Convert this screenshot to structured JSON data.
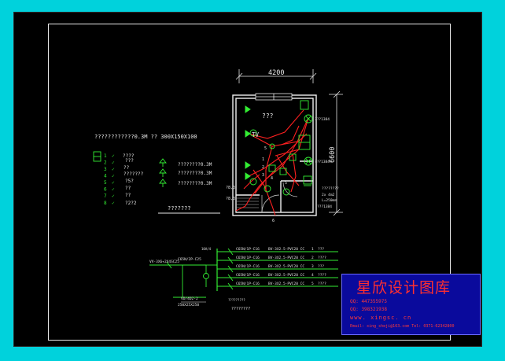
{
  "plan": {
    "width_dim": "4200",
    "height_dim": "6600",
    "room_label": "???",
    "tv_label": "TV",
    "panel_note_1": "???1384",
    "panel_note_2": "???1384",
    "side_note_1": "????????",
    "side_note_2": "2x 4m2",
    "side_note_3": "L=250mm",
    "side_note_4": "???1384",
    "left_tag_1": "?8,3",
    "left_tag_2": "?8,3",
    "circuit_nums": [
      "5",
      "1",
      "2",
      "3",
      "4",
      "5",
      "6"
    ]
  },
  "legend": {
    "heading": "????????????0.3M ?? 300X150X100",
    "items": [
      {
        "num": "1",
        "mark": "✓",
        "text": "????"
      },
      {
        "num": "2",
        "mark": "✓",
        "text": "???"
      },
      {
        "num": "3",
        "mark": "✓",
        "text": "??"
      },
      {
        "num": "4",
        "mark": "✓",
        "text": "???????"
      },
      {
        "num": "5",
        "mark": "✓",
        "text": "?5?"
      },
      {
        "num": "6",
        "mark": "✓",
        "text": "??"
      },
      {
        "num": "7",
        "mark": "✓",
        "text": "??"
      },
      {
        "num": "8",
        "mark": "✓",
        "text": "?2?2"
      }
    ],
    "right_notes": [
      "????????0.3M",
      "????????0.3M",
      "????????0.3M"
    ],
    "caption": "???????"
  },
  "schematic": {
    "feeder_label": "VV-3X6+2X4SC25",
    "main_breaker": "C65N/2P-C25",
    "meter_label": "10A/4",
    "ground_label": "VD/4D2-2",
    "ground_spec": "250X25X250",
    "caption": "????????",
    "left_note": "?????????",
    "branches": [
      {
        "breaker": "C65N/1P-C16",
        "cable": "BV-3X2.5-PVC20 CC",
        "num": "1",
        "load": "???"
      },
      {
        "breaker": "C65N/1P-C16",
        "cable": "BV-3X2.5-PVC20 CC",
        "num": "2",
        "load": "????"
      },
      {
        "breaker": "C65N/1P-C16",
        "cable": "BV-3X2.5-PVC20 CC",
        "num": "3",
        "load": "???"
      },
      {
        "breaker": "C65N/1P-C16",
        "cable": "BV-3X2.5-PVC20 CC",
        "num": "4",
        "load": "????"
      },
      {
        "breaker": "C65N/1P-C16",
        "cable": "BV-3X2.5-PVC20 CC",
        "num": "5",
        "load": "????"
      }
    ]
  },
  "stamp": {
    "title": "星欣设计图库",
    "qq1": "QQ: 447355975",
    "qq2": "QQ: 398321938",
    "site": "www. xingsc. cn",
    "email": "Email: xing_sheji@163.com   Tel: 0371-62342800"
  },
  "colors": {
    "background": "#00d2dc",
    "sheet": "#000000",
    "wire": "#ff2020",
    "symbol": "#33ee33",
    "wall": "#f0f0f0",
    "stamp_bg": "#0a0a9c",
    "stamp_text": "#ff2f2f"
  }
}
